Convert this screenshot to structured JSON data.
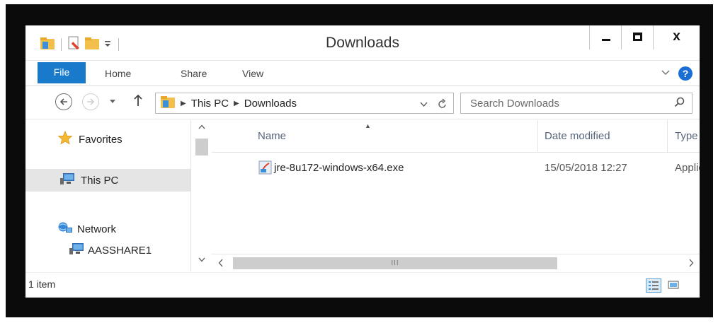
{
  "window": {
    "title": "Downloads",
    "close_glyph": "x"
  },
  "ribbon": {
    "tabs": [
      "File",
      "Home",
      "Share",
      "View"
    ],
    "help_glyph": "?"
  },
  "address": {
    "crumbs": [
      "This PC",
      "Downloads"
    ]
  },
  "search": {
    "placeholder": "Search Downloads"
  },
  "nav": {
    "favorites": "Favorites",
    "this_pc": "This PC",
    "network": "Network",
    "aasshare": "AASSHARE1"
  },
  "list": {
    "columns": [
      "Name",
      "Date modified",
      "Type"
    ],
    "files": [
      {
        "name": "jre-8u172-windows-x64.exe",
        "date": "15/05/2018 12:27",
        "type": "Applicat"
      }
    ]
  },
  "status": {
    "count": "1 item"
  },
  "scroll": {
    "grip": "III"
  },
  "colors": {
    "file_tab": "#1979ca",
    "help": "#1a6fd4",
    "folder": "#f2c04a"
  }
}
